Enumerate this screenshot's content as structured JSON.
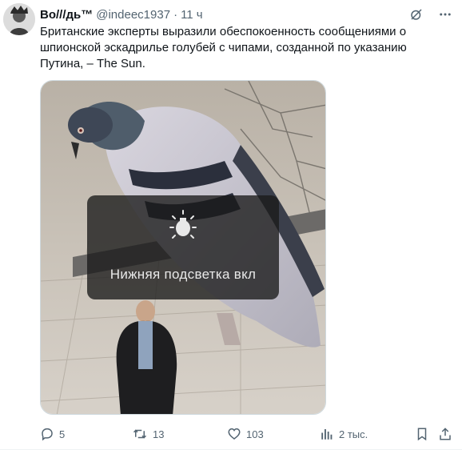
{
  "author": {
    "display_name": "Во///дь™",
    "handle": "@indeec1937",
    "separator": "·",
    "time": "11 ч",
    "avatar_icon": "avatar-portrait-icon"
  },
  "tweet": {
    "text": "Британские эксперты выразили обеспокоенность сообщениями о шпионской эскадрилье голубей с чипами, созданной по указанию Путина, – The Sun."
  },
  "media": {
    "overlay_text": "Нижняя подсветка вкл",
    "overlay_icon": "lightbulb-icon"
  },
  "actions": {
    "replies": "5",
    "retweets": "13",
    "likes": "103",
    "views": "2 тыс."
  },
  "colors": {
    "text": "#0f1419",
    "secondary": "#536471",
    "border": "#cfd9de"
  }
}
